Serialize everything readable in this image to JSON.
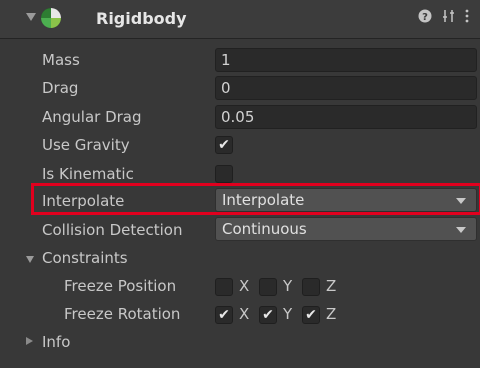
{
  "component": {
    "title": "Rigidbody",
    "icon": "rigidbody-sphere-icon",
    "header_icons": [
      "help-icon",
      "presets-icon",
      "kebab-menu-icon"
    ]
  },
  "fields": {
    "mass": {
      "label": "Mass",
      "value": "1"
    },
    "drag": {
      "label": "Drag",
      "value": "0"
    },
    "angular_drag": {
      "label": "Angular Drag",
      "value": "0.05"
    },
    "use_gravity": {
      "label": "Use Gravity",
      "checked": true
    },
    "is_kinematic": {
      "label": "Is Kinematic",
      "checked": false
    },
    "interpolate": {
      "label": "Interpolate",
      "value": "Interpolate"
    },
    "collision_detection": {
      "label": "Collision Detection",
      "value": "Continuous"
    }
  },
  "constraints": {
    "label": "Constraints",
    "freeze_position": {
      "label": "Freeze Position",
      "x": false,
      "y": false,
      "z": false
    },
    "freeze_rotation": {
      "label": "Freeze Rotation",
      "x": true,
      "y": true,
      "z": true
    },
    "axis_labels": {
      "x": "X",
      "y": "Y",
      "z": "Z"
    }
  },
  "info": {
    "label": "Info"
  },
  "colors": {
    "highlight": "#e1001e",
    "panel_bg": "#383838",
    "field_bg": "#2a2a2a"
  }
}
